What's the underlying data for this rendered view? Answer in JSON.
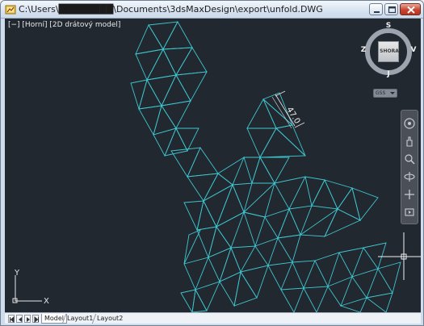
{
  "window": {
    "title": "C:\\Users\\████████\\Documents\\3dsMaxDesign\\export\\unfold.DWG",
    "controls": [
      "minimize",
      "maximize",
      "close"
    ]
  },
  "viewport": {
    "label": "[−] [Horní] [2D drátový model]",
    "background": "#222830",
    "line_color": "#3ec6cf",
    "dimension_text": "47.0",
    "ucs": {
      "x_label": "X",
      "y_label": "Y"
    }
  },
  "viewcube": {
    "face": "SHORA",
    "north": "S",
    "south": "J",
    "west": "Z",
    "east": "V"
  },
  "wcs_menu": {
    "label": "GSS"
  },
  "navigation_bar": {
    "tools": [
      "steering-wheel",
      "pan",
      "zoom",
      "orbit",
      "showmotion"
    ]
  },
  "tabs": {
    "nav_buttons": [
      "first",
      "previous",
      "next",
      "last"
    ],
    "items": [
      {
        "label": "Model",
        "active": true
      },
      {
        "label": "Layout1",
        "active": false
      },
      {
        "label": "Layout2",
        "active": false
      }
    ]
  }
}
